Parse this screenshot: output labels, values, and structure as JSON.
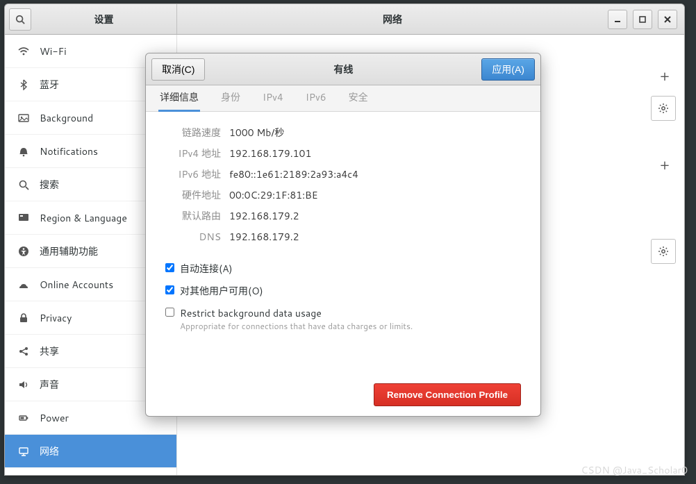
{
  "titlebar": {
    "left_title": "设置",
    "center_title": "网络"
  },
  "sidebar": {
    "items": [
      {
        "label": "Wi-Fi",
        "icon": "wifi"
      },
      {
        "label": "蓝牙",
        "icon": "bluetooth"
      },
      {
        "label": "Background",
        "icon": "background"
      },
      {
        "label": "Notifications",
        "icon": "bell"
      },
      {
        "label": "搜索",
        "icon": "search"
      },
      {
        "label": "Region & Language",
        "icon": "region"
      },
      {
        "label": "通用辅助功能",
        "icon": "accessibility"
      },
      {
        "label": "Online Accounts",
        "icon": "online-accounts"
      },
      {
        "label": "Privacy",
        "icon": "privacy"
      },
      {
        "label": "共享",
        "icon": "share"
      },
      {
        "label": "声音",
        "icon": "sound"
      },
      {
        "label": "Power",
        "icon": "power"
      },
      {
        "label": "网络",
        "icon": "network"
      }
    ],
    "selected_index": 12
  },
  "dialog": {
    "title": "有线",
    "cancel_label": "取消(C)",
    "apply_label": "应用(A)",
    "tabs": [
      "详细信息",
      "身份",
      "IPv4",
      "IPv6",
      "安全"
    ],
    "active_tab_index": 0,
    "details": {
      "rows": [
        {
          "label": "链路速度",
          "value": "1000 Mb/秒"
        },
        {
          "label": "IPv4 地址",
          "value": "192.168.179.101"
        },
        {
          "label": "IPv6 地址",
          "value": "fe80::1e61:2189:2a93:a4c4"
        },
        {
          "label": "硬件地址",
          "value": "00:0C:29:1F:81:BE"
        },
        {
          "label": "默认路由",
          "value": "192.168.179.2"
        },
        {
          "label": "DNS",
          "value": "192.168.179.2"
        }
      ],
      "checkboxes": {
        "auto_connect": {
          "label": "自动连接(A)",
          "checked": true
        },
        "all_users": {
          "label": "对其他用户可用(O)",
          "checked": true
        },
        "restrict": {
          "label": "Restrict background data usage",
          "desc": "Appropriate for connections that have data charges or limits.",
          "checked": false
        }
      }
    },
    "remove_button": "Remove Connection Profile"
  },
  "watermark": "CSDN @Java_Scholar0"
}
